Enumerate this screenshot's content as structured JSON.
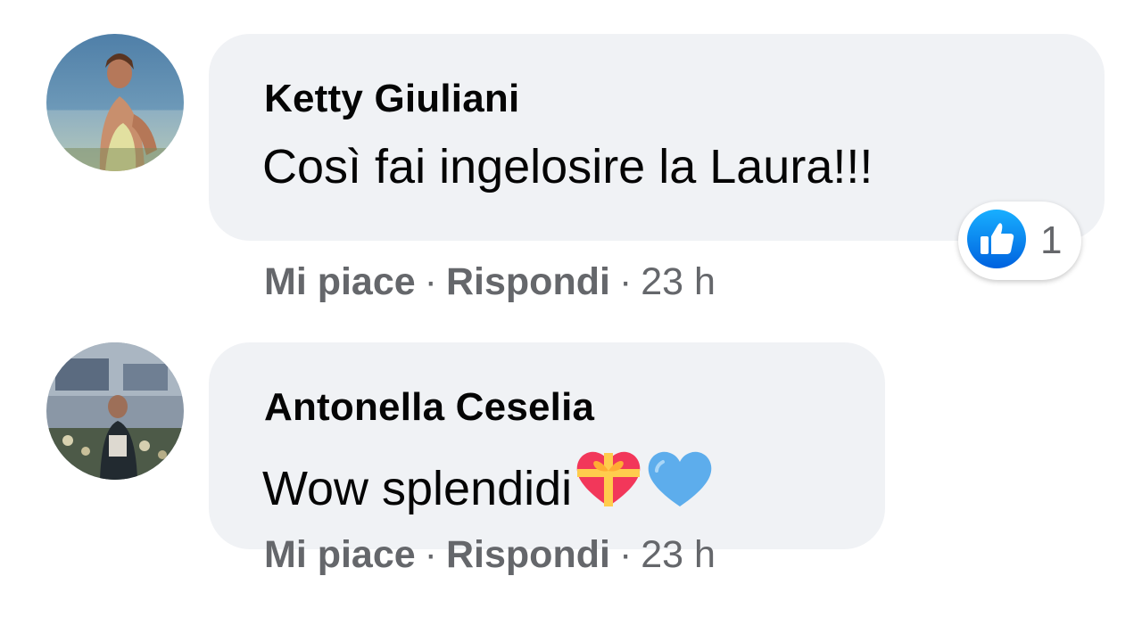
{
  "comments": [
    {
      "author": "Ketty Giuliani",
      "text": "Così fai ingelosire la Laura!!!",
      "emojis": [],
      "reactions": {
        "icon": "like-icon",
        "count": "1"
      },
      "actions": {
        "like": "Mi piace",
        "reply": "Rispondi",
        "time": "23 h",
        "separator": "·"
      }
    },
    {
      "author": "Antonella Ceselia",
      "text": "Wow splendidi",
      "emojis": [
        "gift-heart-emoji",
        "blue-heart-emoji"
      ],
      "actions": {
        "like": "Mi piace",
        "reply": "Rispondi",
        "time": "23 h",
        "separator": "·"
      }
    }
  ],
  "colors": {
    "bubble": "#f0f2f5",
    "meta_text": "#65676b",
    "like_blue": "#1877f2",
    "body_text": "#050505"
  }
}
